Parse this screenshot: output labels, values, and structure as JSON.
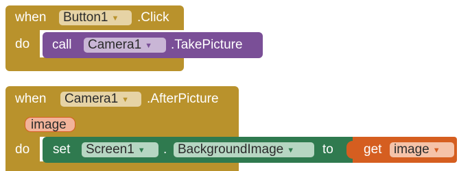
{
  "colors": {
    "event": "#b9922c",
    "procedure_call": "#7a4f97",
    "setter": "#2f7a4f",
    "getter": "#d55e20"
  },
  "block1": {
    "when": "when",
    "component": "Button1",
    "event": ".Click",
    "do": "do",
    "call": {
      "keyword": "call",
      "component": "Camera1",
      "method": ".TakePicture"
    }
  },
  "block2": {
    "when": "when",
    "component": "Camera1",
    "event": ".AfterPicture",
    "param": "image",
    "do": "do",
    "set": {
      "keyword": "set",
      "component": "Screen1",
      "dot": ".",
      "property": "BackgroundImage",
      "to": "to"
    },
    "get": {
      "keyword": "get",
      "variable": "image"
    }
  }
}
